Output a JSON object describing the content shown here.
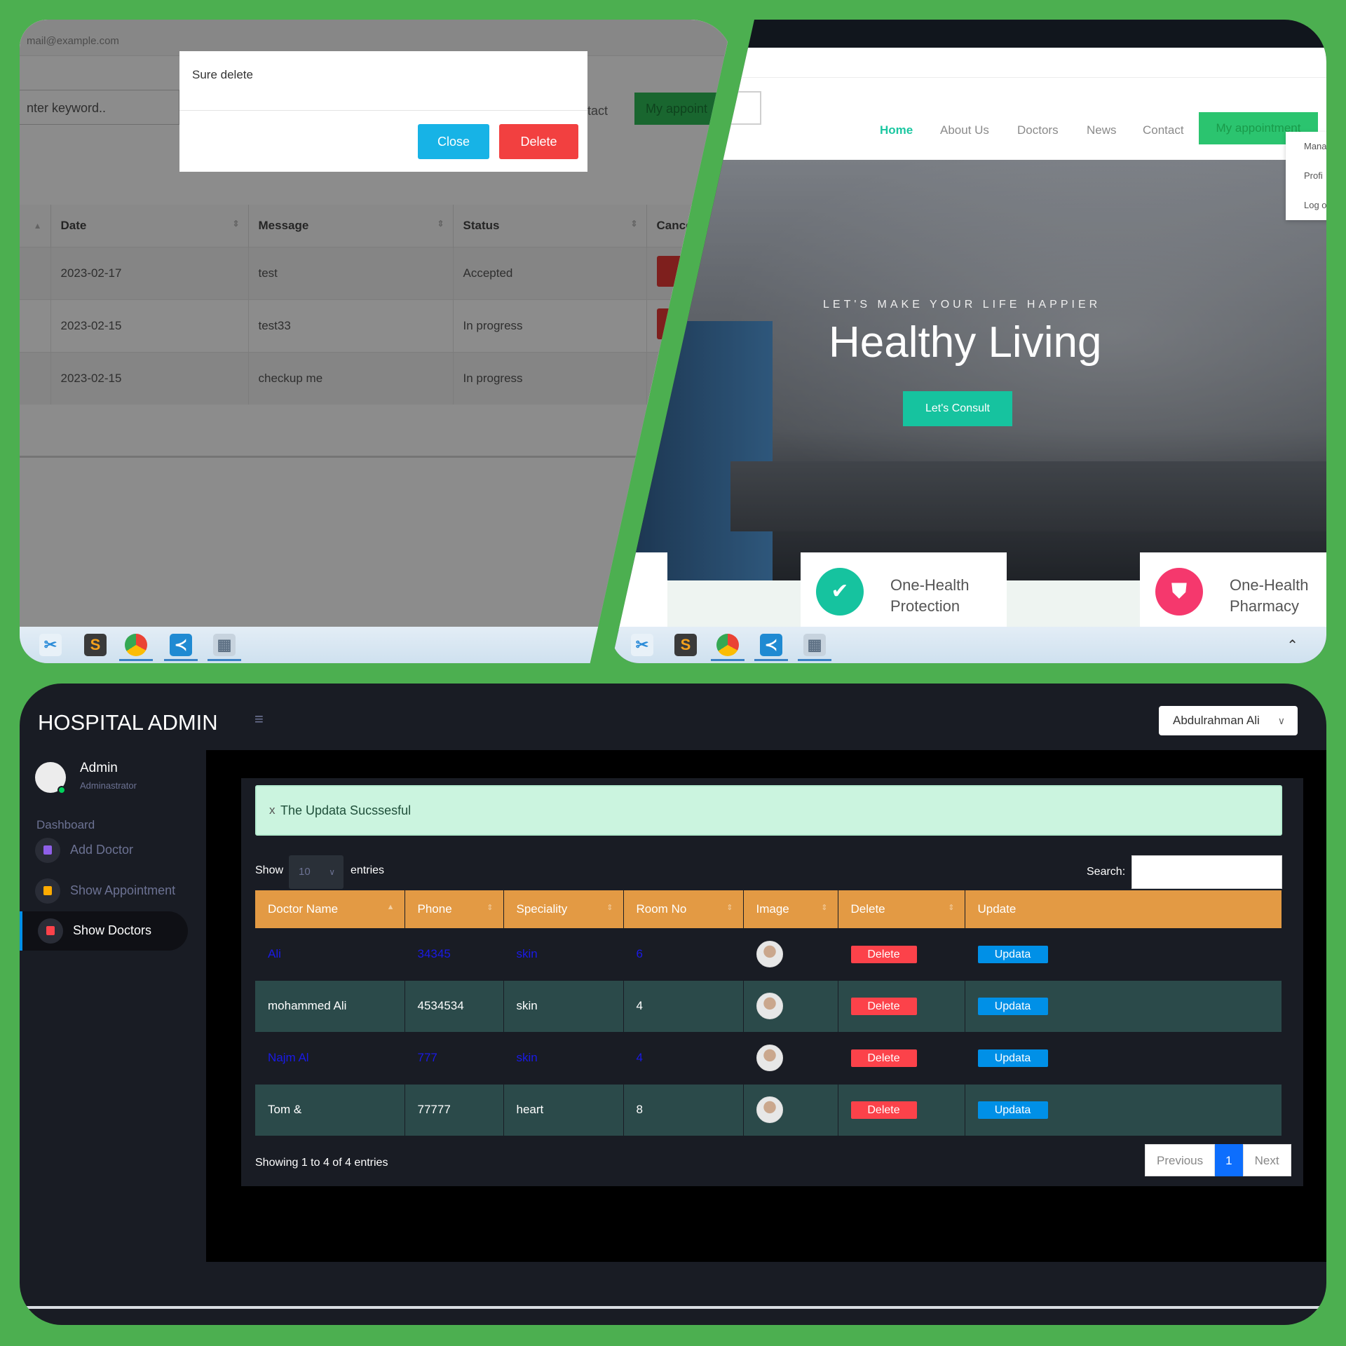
{
  "colors": {
    "background": "#4caf50",
    "accent_teal": "#16c39f",
    "danger": "#fc424a",
    "info_blue": "#0090e7",
    "table_header": "#e39a44",
    "dashboard_bg": "#191c24"
  },
  "panel1": {
    "email": "mail@example.com",
    "search_placeholder": "nter keyword..",
    "nav_contact": "ntact",
    "nav_appointment": "My appoint",
    "dialog": {
      "title": "Sure delete",
      "close_label": "Close",
      "delete_label": "Delete"
    },
    "table": {
      "headers": [
        "Date",
        "Message",
        "Status",
        "Cancel"
      ],
      "rows": [
        {
          "date": "2023-02-17",
          "message": "test",
          "status": "Accepted"
        },
        {
          "date": "2023-02-15",
          "message": "test33",
          "status": "In progress"
        },
        {
          "date": "2023-02-15",
          "message": "checkup me",
          "status": "In progress"
        }
      ]
    }
  },
  "panel2": {
    "nav": {
      "home": "Home",
      "about": "About Us",
      "doctors": "Doctors",
      "news": "News",
      "contact": "Contact",
      "appointment": "My appointment"
    },
    "dropdown": [
      "Mana",
      "Profi",
      "Log o"
    ],
    "hero": {
      "tagline": "LET'S MAKE YOUR LIFE HAPPIER",
      "headline": "Healthy Living",
      "button": "Let's Consult"
    },
    "cards": {
      "partial": "a",
      "protection_line1": "One-Health",
      "protection_line2": "Protection",
      "pharmacy_line1": "One-Health",
      "pharmacy_line2": "Pharmacy"
    }
  },
  "panel3": {
    "brand": "HOSPITAL ADMIN",
    "user_menu": "Abdulrahman Ali",
    "profile": {
      "name": "Admin",
      "role": "Adminastrator"
    },
    "sidebar": {
      "section": "Dashboard",
      "items": [
        {
          "label": "Add Doctor",
          "icon_color": "#8f5fe8"
        },
        {
          "label": "Show Appointment",
          "icon_color": "#ffab00"
        },
        {
          "label": "Show Doctors",
          "icon_color": "#fc424a"
        }
      ]
    },
    "alert": {
      "close": "x",
      "message": "The Updata Sucssesful"
    },
    "show_label": "Show",
    "entries_value": "10",
    "entries_label": "entries",
    "search_label": "Search:",
    "table": {
      "headers": [
        "Doctor Name",
        "Phone",
        "Speciality",
        "Room No",
        "Image",
        "Delete",
        "Update"
      ],
      "rows": [
        {
          "name": "Ali",
          "phone": "34345",
          "speciality": "skin",
          "room": "6",
          "delete": "Delete",
          "update": "Updata"
        },
        {
          "name": "mohammed Ali",
          "phone": "4534534",
          "speciality": "skin",
          "room": "4",
          "delete": "Delete",
          "update": "Updata"
        },
        {
          "name": "Najm Al",
          "phone": "777",
          "speciality": "skin",
          "room": "4",
          "delete": "Delete",
          "update": "Updata"
        },
        {
          "name": "Tom &",
          "phone": "77777",
          "speciality": "heart",
          "room": "8",
          "delete": "Delete",
          "update": "Updata"
        }
      ]
    },
    "info": "Showing 1 to 4 of 4 entries",
    "pager": {
      "previous": "Previous",
      "current": "1",
      "next": "Next"
    }
  }
}
